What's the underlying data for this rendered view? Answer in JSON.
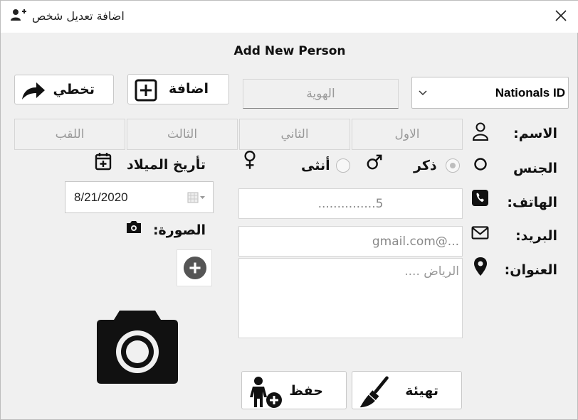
{
  "window": {
    "title": "اضافة تعديل شخص"
  },
  "form": {
    "heading": "Add New Person"
  },
  "toolbar": {
    "skip_label": "تخطي",
    "add_label": "اضافة",
    "id_placeholder": "الهوية",
    "id_type_value": "Nationals ID"
  },
  "name": {
    "label": "الاسم:",
    "first": "الاول",
    "second": "الثاني",
    "third": "الثالث",
    "last": "اللقب"
  },
  "gender": {
    "label": "الجنس",
    "male": "ذكر",
    "female": "أنثى",
    "selected": "male"
  },
  "birth": {
    "label": "تأريخ الميلاد",
    "date": "8/21/2020"
  },
  "phone": {
    "label": "الهاتف:",
    "placeholder": "5..............."
  },
  "email": {
    "label": "البريد:",
    "placeholder": "gmail.com@..."
  },
  "address": {
    "label": "العنوان:",
    "placeholder": "الرياض ...."
  },
  "photo": {
    "label": "الصورة:"
  },
  "actions": {
    "save_label": "حفظ",
    "reset_label": "تهيئة"
  },
  "icons": {
    "title": "add-person-icon",
    "close": "close-icon",
    "skip": "share-arrow-icon",
    "add": "plus-square-icon",
    "name": "user-icon",
    "gender": "circle-icon",
    "phone": "phone-icon",
    "email": "envelope-icon",
    "address": "map-pin-icon",
    "male": "male-symbol-icon",
    "female": "female-symbol-icon",
    "birth": "calendar-plus-icon",
    "photo": "camera-icon",
    "save": "person-add-icon",
    "reset": "broom-icon"
  }
}
